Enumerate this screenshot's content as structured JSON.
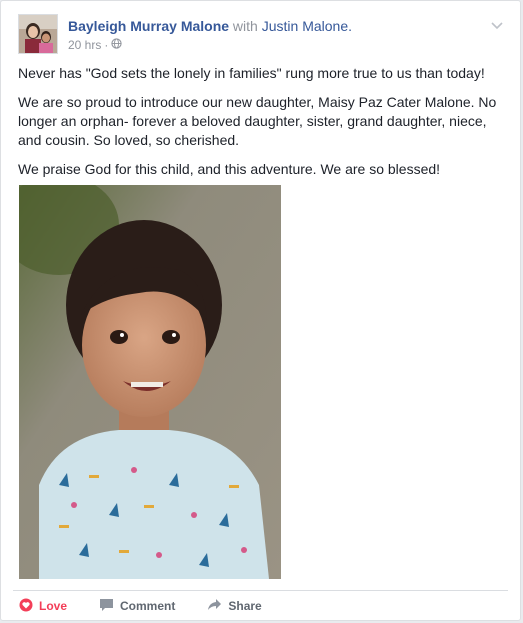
{
  "post": {
    "author": "Bayleigh Murray Malone",
    "with_text": " with ",
    "tagged": "Justin Malone.",
    "time": "20 hrs",
    "separator": " · ",
    "paragraphs": [
      "Never has \"God sets the lonely in families\" rung more true to us than today!",
      "We are so proud to introduce our new daughter, Maisy Paz Cater Malone. No longer an orphan- forever a beloved daughter, sister, grand daughter, niece, and cousin. So loved, so cherished.",
      "We praise God for this child, and this adventure. We are so blessed!"
    ]
  },
  "actions": {
    "love": "Love",
    "comment": "Comment",
    "share": "Share"
  },
  "icons": {
    "audience": "globe-icon",
    "menu": "chevron-down-icon",
    "love": "heart-icon",
    "comment": "comment-icon",
    "share": "share-icon"
  },
  "colors": {
    "link": "#365899",
    "muted": "#90949c",
    "love": "#f33e58",
    "action": "#606770"
  }
}
